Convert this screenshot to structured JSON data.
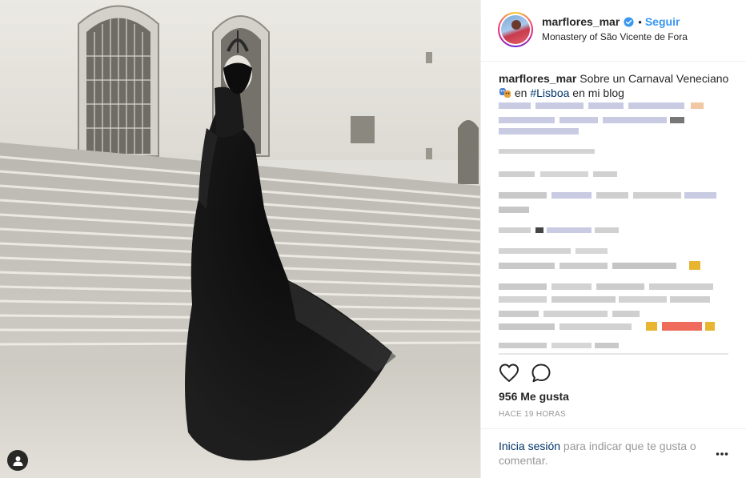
{
  "post": {
    "author": {
      "username": "marflores_mar",
      "verified": true,
      "follow_label": "Seguir",
      "separator": "•",
      "location": "Monastery of São Vicente de Fora"
    },
    "caption": {
      "username": "marflores_mar",
      "text_before": "Sobre un Carnaval Veneciano ",
      "emoji": "performing-arts-mask-icon",
      "text_middle": " en ",
      "hashtag": "#Lisboa",
      "text_after": " en mi blog"
    },
    "actions": {
      "like_icon": "heart-icon",
      "comment_icon": "comment-bubble-icon"
    },
    "likes": "956 Me gusta",
    "timestamp": "HACE 19 HORAS",
    "login_prompt": {
      "link": "Inicia sesión",
      "text": " para indicar que te gusta o comentar."
    },
    "more_icon": "more-options-icon"
  },
  "colors": {
    "link_blue": "#3897f0",
    "hashtag_navy": "#003569",
    "muted": "#999999",
    "text": "#262626"
  }
}
